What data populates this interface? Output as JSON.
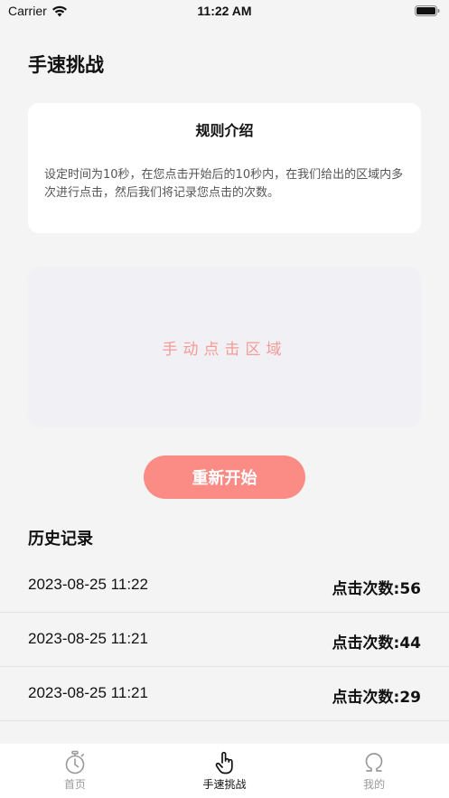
{
  "status_bar": {
    "carrier": "Carrier",
    "time": "11:22 AM"
  },
  "header": {
    "title": "手速挑战"
  },
  "rules": {
    "title": "规则介绍",
    "description": "设定时间为10秒，在您点击开始后的10秒内，在我们给出的区域内多次进行点击，然后我们将记录您点击的次数。"
  },
  "tap_area": {
    "label": "手动点击区域"
  },
  "restart_button": {
    "label": "重新开始"
  },
  "history": {
    "title": "历史记录",
    "records": [
      {
        "date": "2023-08-25 11:22",
        "count": "点击次数:56"
      },
      {
        "date": "2023-08-25 11:21",
        "count": "点击次数:44"
      },
      {
        "date": "2023-08-25 11:21",
        "count": "点击次数:29"
      }
    ]
  },
  "tab_bar": {
    "tabs": [
      {
        "label": "首页",
        "icon": "stopwatch-icon",
        "active": false
      },
      {
        "label": "手速挑战",
        "icon": "hand-pointer-icon",
        "active": true
      },
      {
        "label": "我的",
        "icon": "omega-icon",
        "active": false
      }
    ]
  },
  "colors": {
    "accent": "#fa8c85",
    "tap_label": "#f49b96",
    "background": "#f4f4f4"
  }
}
